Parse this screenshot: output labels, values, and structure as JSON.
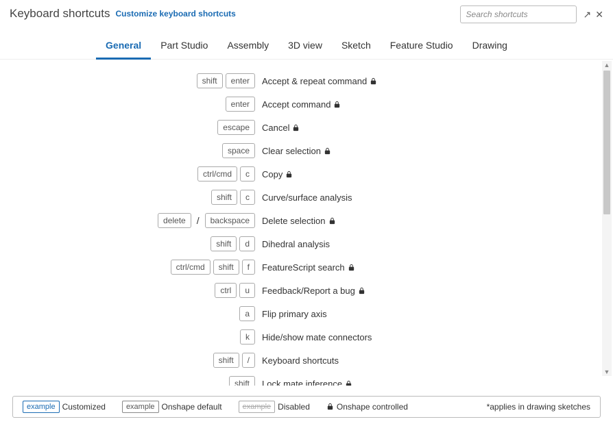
{
  "header": {
    "title": "Keyboard shortcuts",
    "customize_link": "Customize keyboard shortcuts",
    "search_placeholder": "Search shortcuts"
  },
  "tabs": [
    {
      "label": "General",
      "active": true
    },
    {
      "label": "Part Studio",
      "active": false
    },
    {
      "label": "Assembly",
      "active": false
    },
    {
      "label": "3D view",
      "active": false
    },
    {
      "label": "Sketch",
      "active": false
    },
    {
      "label": "Feature Studio",
      "active": false
    },
    {
      "label": "Drawing",
      "active": false
    }
  ],
  "shortcuts": [
    {
      "keys": [
        {
          "k": "shift"
        },
        {
          "k": "enter"
        }
      ],
      "desc": "Accept & repeat command",
      "locked": true
    },
    {
      "keys": [
        {
          "k": "enter"
        }
      ],
      "desc": "Accept command",
      "locked": true
    },
    {
      "keys": [
        {
          "k": "escape"
        }
      ],
      "desc": "Cancel",
      "locked": true
    },
    {
      "keys": [
        {
          "k": "space"
        }
      ],
      "desc": "Clear selection",
      "locked": true
    },
    {
      "keys": [
        {
          "k": "ctrl/cmd"
        },
        {
          "k": "c"
        }
      ],
      "desc": "Copy",
      "locked": true
    },
    {
      "keys": [
        {
          "k": "shift"
        },
        {
          "k": "c"
        }
      ],
      "desc": "Curve/surface analysis",
      "locked": false
    },
    {
      "keys": [
        {
          "k": "delete"
        },
        {
          "sep": "/"
        },
        {
          "k": "backspace"
        }
      ],
      "desc": "Delete selection",
      "locked": true
    },
    {
      "keys": [
        {
          "k": "shift"
        },
        {
          "k": "d"
        }
      ],
      "desc": "Dihedral analysis",
      "locked": false
    },
    {
      "keys": [
        {
          "k": "ctrl/cmd"
        },
        {
          "k": "shift"
        },
        {
          "k": "f"
        }
      ],
      "desc": "FeatureScript search",
      "locked": true
    },
    {
      "keys": [
        {
          "k": "ctrl"
        },
        {
          "k": "u"
        }
      ],
      "desc": "Feedback/Report a bug",
      "locked": true
    },
    {
      "keys": [
        {
          "k": "a"
        }
      ],
      "desc": "Flip primary axis",
      "locked": false
    },
    {
      "keys": [
        {
          "k": "k"
        }
      ],
      "desc": "Hide/show mate connectors",
      "locked": false
    },
    {
      "keys": [
        {
          "k": "shift"
        },
        {
          "k": "/"
        }
      ],
      "desc": "Keyboard shortcuts",
      "locked": false
    }
  ],
  "partial_row": {
    "keys": [
      {
        "k": "shift"
      }
    ],
    "desc": "Lock mate inference",
    "locked": true
  },
  "legend": {
    "customized": {
      "key": "example",
      "label": "Customized"
    },
    "default": {
      "key": "example",
      "label": "Onshape default"
    },
    "disabled": {
      "key": "example",
      "label": "Disabled"
    },
    "controlled": {
      "label": "Onshape controlled"
    },
    "note": "*applies in drawing sketches"
  }
}
